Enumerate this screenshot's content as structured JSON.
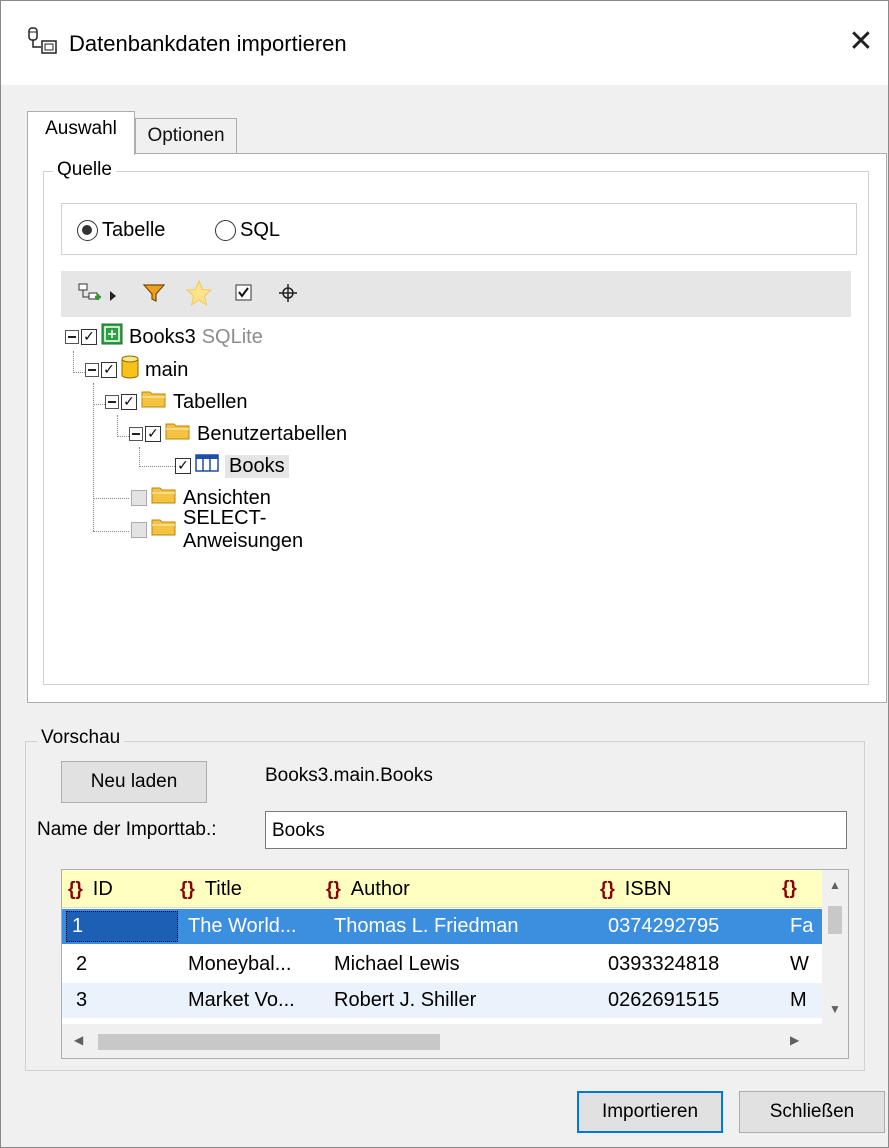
{
  "window": {
    "title": "Datenbankdaten importieren",
    "close_glyph": "✕"
  },
  "tabs": [
    {
      "label": "Auswahl",
      "active": true
    },
    {
      "label": "Optionen",
      "active": false
    }
  ],
  "source": {
    "group_label": "Quelle",
    "radio_options": [
      {
        "label": "Tabelle",
        "selected": true
      },
      {
        "label": "SQL",
        "selected": false
      }
    ],
    "toolbar_icons": [
      "add-datasource-icon",
      "dropdown-arrow-icon",
      "filter-icon",
      "favorite-star-icon",
      "checked-items-icon",
      "locate-icon"
    ],
    "tree": {
      "connection": {
        "label": "Books3",
        "sublabel": "SQLite",
        "checked": true
      },
      "schema": {
        "label": "main",
        "checked": true
      },
      "tables_folder": {
        "label": "Tabellen",
        "checked": true
      },
      "user_tables_folder": {
        "label": "Benutzertabellen",
        "checked": true
      },
      "table": {
        "label": "Books",
        "checked": true
      },
      "views_folder": {
        "label": "Ansichten",
        "checked": false
      },
      "select_folder": {
        "label": "SELECT-Anweisungen",
        "checked": false
      }
    }
  },
  "preview": {
    "group_label": "Vorschau",
    "reload_label": "Neu laden",
    "path": "Books3.main.Books",
    "import_name_label": "Name der Importtab.:",
    "import_name_value": "Books",
    "columns": [
      "ID",
      "Title",
      "Author",
      "ISBN",
      ""
    ],
    "rows": [
      {
        "id": "1",
        "title": "The World...",
        "author": "Thomas L. Friedman",
        "isbn": "0374292795",
        "extra": "Fa"
      },
      {
        "id": "2",
        "title": "Moneybal...",
        "author": "Michael Lewis",
        "isbn": "0393324818",
        "extra": "W"
      },
      {
        "id": "3",
        "title": "Market Vo...",
        "author": "Robert J. Shiller",
        "isbn": "0262691515",
        "extra": "M"
      }
    ],
    "selected_row": 0
  },
  "buttons": {
    "import": "Importieren",
    "close": "Schließen"
  },
  "colors": {
    "accent": "#0078d7",
    "selection": "#3c8fde",
    "header_bg": "#ffffc0",
    "folder": "#f5c342",
    "db_cylinder": "#f8c21a",
    "connection_green": "#2ea043"
  }
}
